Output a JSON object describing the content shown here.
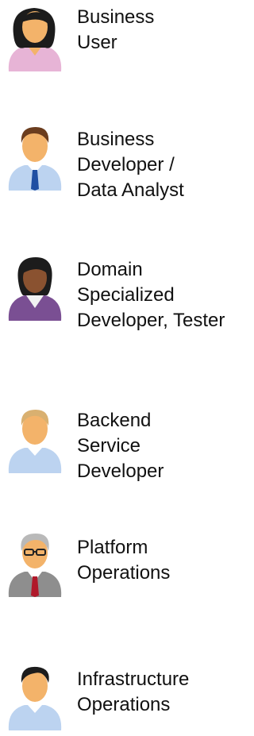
{
  "roles": [
    {
      "icon": "business-user-icon",
      "lines": [
        "Business",
        "User"
      ]
    },
    {
      "icon": "business-developer-icon",
      "lines": [
        "Business",
        "Developer /",
        "Data Analyst"
      ]
    },
    {
      "icon": "domain-developer-icon",
      "lines": [
        "Domain",
        "Specialized",
        "Developer, Tester"
      ]
    },
    {
      "icon": "backend-developer-icon",
      "lines": [
        "Backend",
        "Service",
        "Developer"
      ]
    },
    {
      "icon": "platform-operations-icon",
      "lines": [
        "Platform",
        "Operations"
      ]
    },
    {
      "icon": "infrastructure-operations-icon",
      "lines": [
        "Infrastructure",
        "Operations"
      ]
    }
  ],
  "colors": {
    "skin_light": "#f3b36a",
    "skin_dark": "#8a5230",
    "hair_black": "#1c1c1c",
    "hair_brown": "#6b3d1e",
    "hair_blond": "#d9b070",
    "hair_gray": "#b9b9b9",
    "shirt_pink": "#e7b4d6",
    "shirt_blue": "#bcd3f0",
    "shirt_purple": "#7a4f93",
    "suit_gray": "#8e8e8e",
    "tie_blue": "#1f4fa3",
    "tie_red": "#b0192a",
    "text": "#111111"
  }
}
